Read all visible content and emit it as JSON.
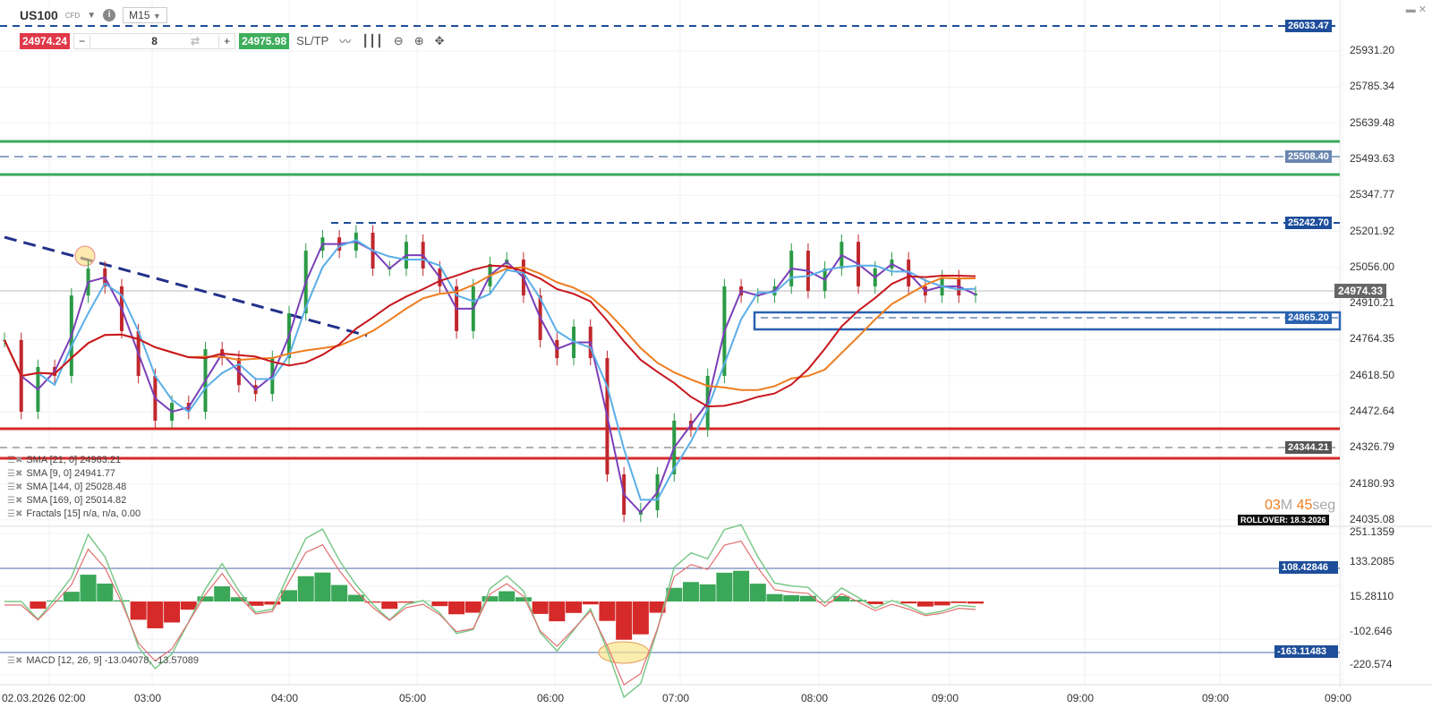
{
  "header": {
    "symbol": "US100",
    "type": "CFD",
    "timeframe": "M15"
  },
  "trade": {
    "sell_price": "24974.24",
    "quantity": "8",
    "buy_price": "24975.98",
    "sltp": "SL/TP",
    "minus": "−",
    "plus": "+"
  },
  "legend": [
    {
      "label": "SMA [21, 0] 24963.21"
    },
    {
      "label": "SMA [9, 0] 24941.77"
    },
    {
      "label": "SMA [144, 0] 25028.48"
    },
    {
      "label": "SMA [169, 0] 25014.82"
    },
    {
      "label": "Fractals [15] n/a, n/a, 0.00"
    }
  ],
  "macd_legend": "MACD [12, 26, 9] -13.04078, -13.57089",
  "price_axis": [
    "25931.20",
    "25785.34",
    "25639.48",
    "25493.63",
    "25347.77",
    "25201.92",
    "25056.00",
    "24910.21",
    "24764.35",
    "24618.50",
    "24472.64",
    "24326.79",
    "24180.93",
    "24035.08"
  ],
  "macd_axis": [
    "251.1359",
    "133.2085",
    "15.28110",
    "-102.646",
    "-220.574"
  ],
  "time_axis": [
    "02.03.2026 02:00",
    "03:00",
    "04:00",
    "05:00",
    "06:00",
    "07:00",
    "08:00",
    "09:00",
    "09:00",
    "09:00",
    "09:00",
    "09:00"
  ],
  "levels": {
    "top": "26033.47",
    "blue_zone": "25508.40",
    "resistance": "25242.70",
    "current": "24974.33",
    "support": "24865.20",
    "lower": "24344.21",
    "macd_high": "108.42846",
    "macd_low": "-163.11483"
  },
  "countdown": {
    "min": "03",
    "m": "M",
    "sec": "45",
    "s": "seg"
  },
  "rollover": "ROLLOVER: 18.3.2026",
  "colors": {
    "sell": "#e0394a",
    "buy": "#3fae5c",
    "navy": "#1e4e9a",
    "sma9": "#7b3fb8",
    "sma21": "#5aaee8",
    "sma144": "#ee7d1f",
    "sma169": "#c8161d"
  },
  "chart_data": {
    "type": "line",
    "series_close": [
      24763,
      24473,
      24654,
      24618,
      24943,
      25052,
      24980,
      24799,
      24618,
      24437,
      24509,
      24473,
      24726,
      24690,
      24581,
      24545,
      24690,
      24871,
      25124,
      25178,
      25124,
      25197,
      25052,
      25052,
      25160,
      25052,
      24980,
      24799,
      24980,
      25070,
      25088,
      24943,
      24763,
      24690,
      24817,
      24690,
      24220,
      24057,
      24075,
      24220,
      24437,
      24401,
      24618,
      24980,
      24943,
      24943,
      24980,
      25124,
      24961,
      25052,
      25160,
      24980,
      25052,
      25088,
      24980,
      24943,
      25016,
      24943,
      24951
    ]
  }
}
